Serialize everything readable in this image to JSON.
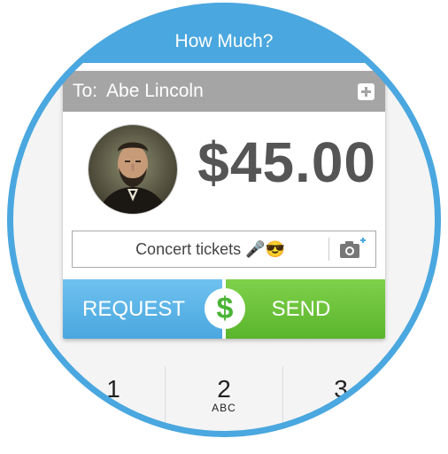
{
  "header": {
    "title": "How Much?"
  },
  "recipient": {
    "to_label": "To:",
    "name": "Abe Lincoln"
  },
  "amount": "$45.00",
  "memo": {
    "text": "Concert tickets 🎤😎"
  },
  "actions": {
    "request_label": "REQUEST",
    "send_label": "SEND",
    "badge_symbol": "$"
  },
  "keypad": [
    {
      "num": "1",
      "letters": ""
    },
    {
      "num": "2",
      "letters": "ABC"
    },
    {
      "num": "3",
      "letters": ""
    }
  ],
  "colors": {
    "accent_blue": "#4aa7df",
    "send_green": "#5ab52c",
    "badge_green": "#4bb436",
    "to_bar_gray": "#a5a5a5"
  },
  "icons": [
    "add-contact-icon",
    "camera-icon",
    "dollar-icon"
  ]
}
